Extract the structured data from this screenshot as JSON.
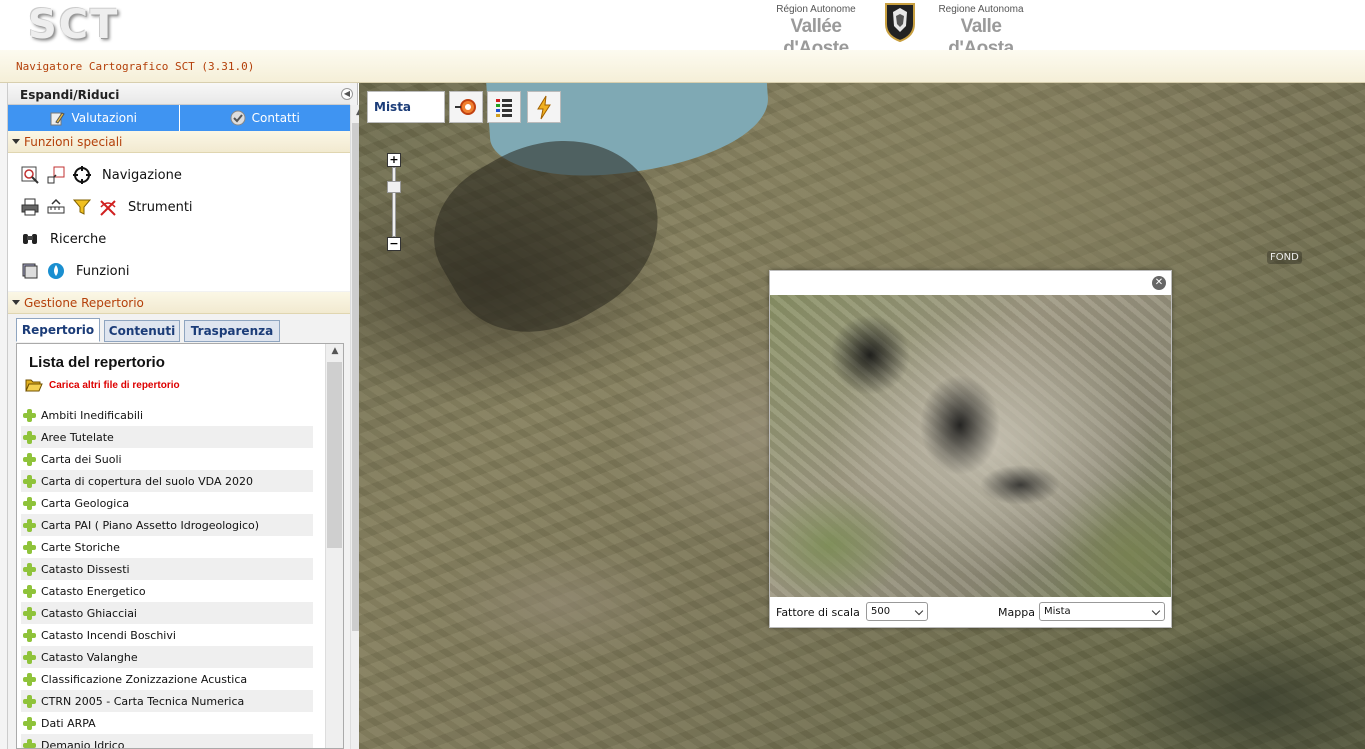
{
  "header": {
    "logo": "SCT",
    "region_left": {
      "small": "Région Autonome",
      "big": "Vallée d'Aoste"
    },
    "region_right": {
      "small": "Regione Autonoma",
      "big": "Valle d'Aosta"
    },
    "app_title": "Navigatore Cartografico SCT (3.31.0)"
  },
  "sidebar": {
    "title": "Espandi/Riduci",
    "top_tabs": [
      {
        "label": "Valutazioni",
        "icon": "pencil-icon"
      },
      {
        "label": "Contatti",
        "icon": "checkmark-icon"
      }
    ],
    "funzioni_speciali": {
      "title": "Funzioni speciali",
      "rows": [
        {
          "label": "Navigazione"
        },
        {
          "label": "Strumenti"
        },
        {
          "label": "Ricerche"
        },
        {
          "label": "Funzioni"
        }
      ]
    },
    "gestione": {
      "title": "Gestione Repertorio",
      "tabs": [
        "Repertorio",
        "Contenuti",
        "Trasparenza"
      ],
      "active_tab": "Repertorio"
    },
    "repertorio": {
      "title": "Lista del repertorio",
      "load_link": "Carica altri file di repertorio",
      "items": [
        "Ambiti Inedificabili",
        "Aree Tutelate",
        "Carta dei Suoli",
        "Carta di copertura del suolo VDA 2020",
        "Carta Geologica",
        "Carta PAI ( Piano Assetto Idrogeologico)",
        "Carte Storiche",
        "Catasto Dissesti",
        "Catasto Energetico",
        "Catasto Ghiacciai",
        "Catasto Incendi Boschivi",
        "Catasto Valanghe",
        "Classificazione Zonizzazione Acustica",
        "CTRN 2005 - Carta Tecnica Numerica",
        "Dati ARPA",
        "Demanio Idrico"
      ]
    }
  },
  "map": {
    "basemap_label": "Mista",
    "place_label": "FOND",
    "zoom_plus": "+",
    "zoom_minus": "−"
  },
  "popup": {
    "title": "",
    "close": "✕",
    "scale_label": "Fattore di scala",
    "scale_value": "500",
    "map_label": "Mappa",
    "map_value": "Mista"
  }
}
